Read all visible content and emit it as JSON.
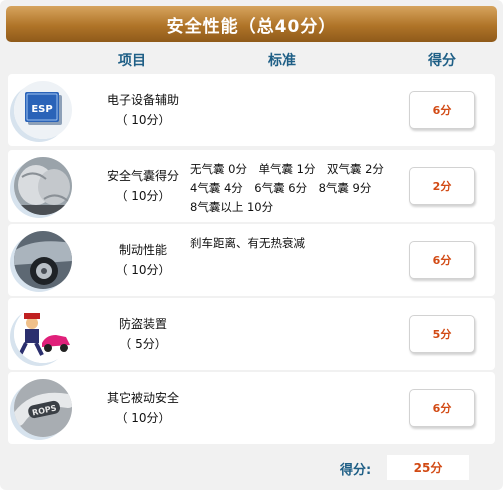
{
  "title": "安全性能（总40分）",
  "columns": {
    "item": "项目",
    "standard": "标准",
    "score": "得分"
  },
  "rows": [
    {
      "name": "电子设备辅助",
      "points": "（ 10分）",
      "standard": [],
      "score": "6分",
      "icon": "esp-icon"
    },
    {
      "name": "安全气囊得分",
      "points": "（ 10分）",
      "standard": [
        "无气囊 0分　单气囊 1分　双气囊 2分",
        "4气囊 4分　6气囊 6分　8气囊 9分",
        "8气囊以上 10分"
      ],
      "score": "2分",
      "icon": "airbag-icon"
    },
    {
      "name": "制动性能",
      "points": "（ 10分）",
      "standard": [
        "刹车距离、有无热衰减"
      ],
      "score": "6分",
      "icon": "brake-wheel-icon"
    },
    {
      "name": "防盗装置",
      "points": "（ 5分）",
      "standard": [],
      "score": "5分",
      "icon": "anti-theft-icon"
    },
    {
      "name": "其它被动安全",
      "points": "（ 10分）",
      "standard": [],
      "score": "6分",
      "icon": "rops-icon"
    }
  ],
  "total": {
    "label": "得分:",
    "value": "25分"
  },
  "colors": {
    "title_bar": "#b07428",
    "heading": "#1f5f86",
    "score": "#d24a14",
    "background": "#f1f1f1"
  }
}
